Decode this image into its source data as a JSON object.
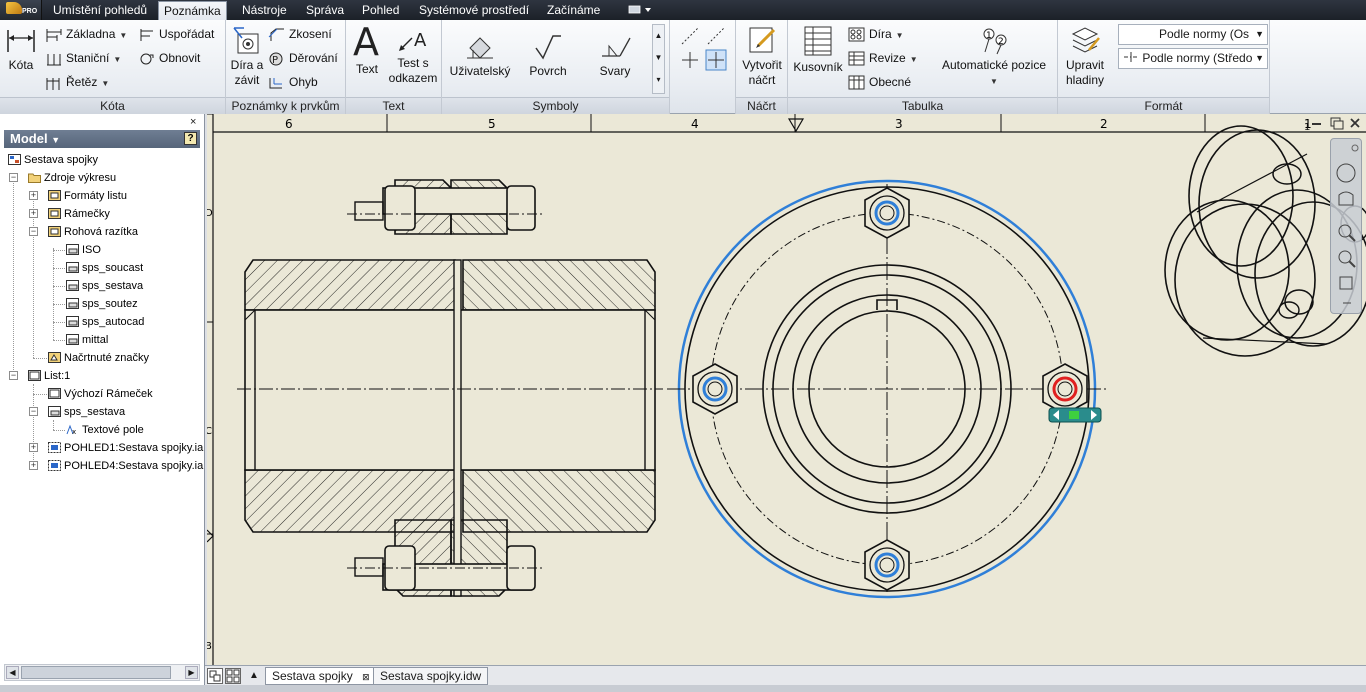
{
  "app": {
    "badge": "PRO"
  },
  "tabs": [
    {
      "label": "Umístění pohledů"
    },
    {
      "label": "Poznámka"
    },
    {
      "label": "Nástroje"
    },
    {
      "label": "Správa"
    },
    {
      "label": "Pohled"
    },
    {
      "label": "Systémové prostředí"
    },
    {
      "label": "Začínáme"
    }
  ],
  "active_tab": "Poznámka",
  "ribbon": {
    "kota": {
      "title": "Kóta",
      "kota_btn": "Kóta",
      "zakladna": "Základna",
      "stanicni": "Staniční",
      "retez": "Řetěz",
      "usporadat": "Uspořádat",
      "obnovit": "Obnovit"
    },
    "poznamky": {
      "title": "Poznámky k prvkům",
      "dira_zavit_1": "Díra a",
      "dira_zavit_2": "závit",
      "zkoseni": "Zkosení",
      "derovani": "Děrování",
      "ohyb": "Ohyb"
    },
    "text": {
      "title": "Text",
      "text_btn": "Text",
      "odkaz_1": "Test s",
      "odkaz_2": "odkazem"
    },
    "symboly": {
      "title": "Symboly",
      "uzivatelsky": "Uživatelský",
      "povrch": "Povrch",
      "svary": "Svary"
    },
    "nacrt": {
      "title": "Náčrt",
      "vytvorit_1": "Vytvořit",
      "vytvorit_2": "náčrt"
    },
    "tabulka": {
      "title": "Tabulka",
      "kusovnik": "Kusovník",
      "dira": "Díra",
      "revize": "Revize",
      "obecne": "Obecné",
      "auto_pozice": "Automatické pozice"
    },
    "format": {
      "title": "Formát",
      "upravit_1": "Upravit",
      "upravit_2": "hladiny",
      "combo_1": "Podle normy (Os",
      "combo_2": "Podle normy (Středo"
    }
  },
  "browser": {
    "title": "Model",
    "close": "×",
    "help": "?",
    "items": [
      {
        "label": "Sestava spojky"
      },
      {
        "label": "Zdroje výkresu"
      },
      {
        "label": "Formáty listu"
      },
      {
        "label": "Rámečky"
      },
      {
        "label": "Rohová razítka"
      },
      {
        "label": "ISO"
      },
      {
        "label": "sps_soucast"
      },
      {
        "label": "sps_sestava"
      },
      {
        "label": "sps_soutez"
      },
      {
        "label": "sps_autocad"
      },
      {
        "label": "mittal"
      },
      {
        "label": "Načrtnuté značky"
      },
      {
        "label": "List:1"
      },
      {
        "label": "Výchozí Rámeček"
      },
      {
        "label": "sps_sestava"
      },
      {
        "label": "Textové pole"
      },
      {
        "label": "POHLED1:Sestava spojky.ia"
      },
      {
        "label": "POHLED4:Sestava spojky.ia"
      }
    ]
  },
  "sheet": {
    "ruler_numbers": [
      "6",
      "5",
      "4",
      "3",
      "2",
      "1"
    ],
    "row_letters": [
      "D",
      "C",
      "B"
    ]
  },
  "documents": [
    {
      "label": "Sestava spojky"
    },
    {
      "label": "Sestava spojky.idw"
    }
  ],
  "colors": {
    "canvas": "#ebe8d7",
    "selection_blue": "#2f7fd8",
    "highlight_red": "#e02020",
    "grip_teal": "#2a8c8c"
  }
}
